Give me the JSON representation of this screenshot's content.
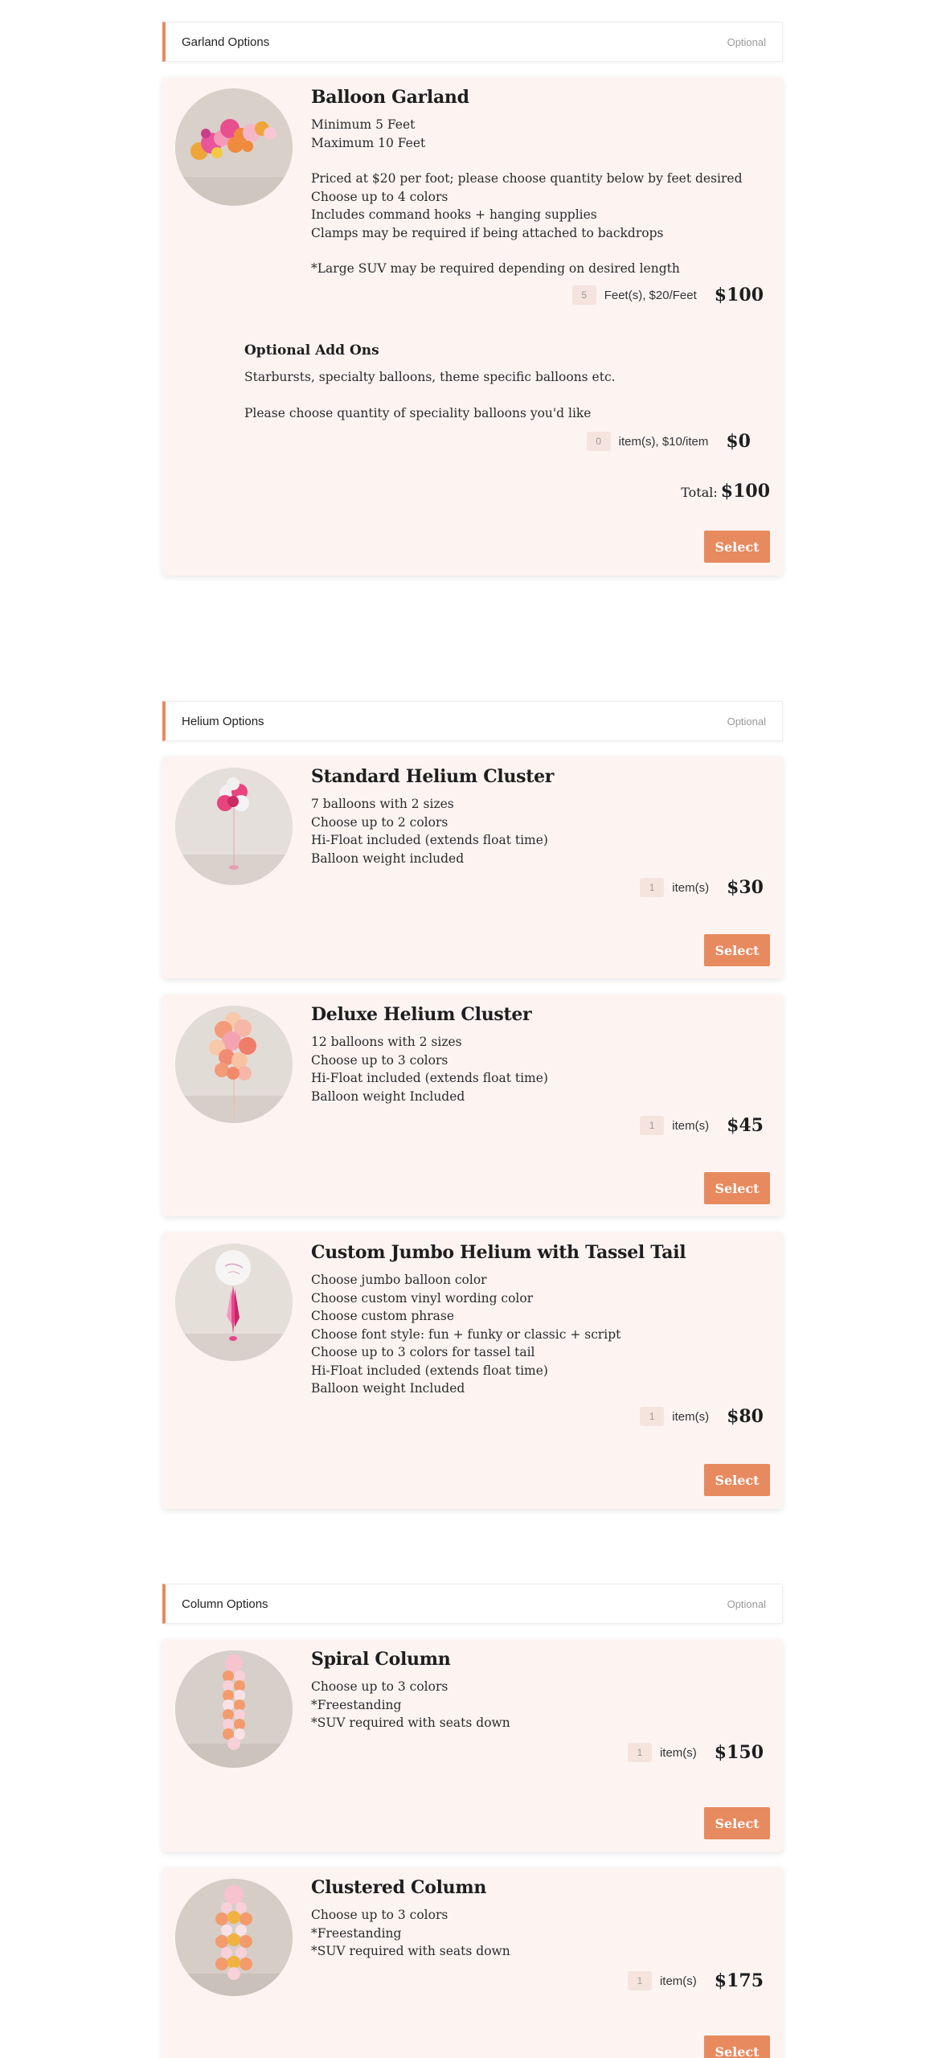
{
  "sections": {
    "garland": {
      "title": "Garland Options",
      "optional": "Optional"
    },
    "helium": {
      "title": "Helium Options",
      "optional": "Optional"
    },
    "column": {
      "title": "Column Options",
      "optional": "Optional"
    }
  },
  "garland": {
    "title": "Balloon Garland",
    "lines": [
      "Minimum 5 Feet",
      "Maximum 10 Feet",
      "",
      "Priced at $20 per foot; please choose quantity below by feet desired",
      "Choose up to 4 colors",
      "Includes command hooks + hanging supplies",
      "Clamps may be required if being attached to backdrops",
      "",
      "*Large SUV may be required depending on desired length"
    ],
    "qty": "5",
    "unit": "Feet(s), $20/Feet",
    "price": "$100",
    "addons": {
      "title": "Optional Add Ons",
      "line1": "Starbursts, specialty balloons, theme specific balloons etc.",
      "line2": "Please choose quantity of speciality balloons you'd like",
      "qty": "0",
      "unit": "item(s), $10/item",
      "price": "$0"
    },
    "total_label": "Total:",
    "total": "$100",
    "select": "Select"
  },
  "standard_helium": {
    "title": "Standard Helium Cluster",
    "lines": [
      "7 balloons with 2 sizes",
      "Choose up to 2 colors",
      "Hi-Float included (extends float time)",
      "Balloon weight included"
    ],
    "qty": "1",
    "unit": "item(s)",
    "price": "$30",
    "select": "Select"
  },
  "deluxe_helium": {
    "title": "Deluxe Helium Cluster",
    "lines": [
      "12 balloons with 2 sizes",
      "Choose up to 3 colors",
      "Hi-Float included (extends float time)",
      "Balloon weight Included"
    ],
    "qty": "1",
    "unit": "item(s)",
    "price": "$45",
    "select": "Select"
  },
  "jumbo_helium": {
    "title": "Custom Jumbo Helium with Tassel Tail",
    "lines": [
      "Choose jumbo balloon color",
      "Choose custom vinyl wording color",
      "Choose custom phrase",
      "Choose font style: fun + funky or classic + script",
      "Choose up to 3 colors for tassel tail",
      "Hi-Float included (extends float time)",
      "Balloon weight Included"
    ],
    "qty": "1",
    "unit": "item(s)",
    "price": "$80",
    "select": "Select"
  },
  "spiral_column": {
    "title": "Spiral Column",
    "lines": [
      "Choose up to 3 colors",
      "*Freestanding",
      "*SUV required with seats down"
    ],
    "qty": "1",
    "unit": "item(s)",
    "price": "$150",
    "select": "Select"
  },
  "clustered_column": {
    "title": "Clustered Column",
    "lines": [
      "Choose up to 3 colors",
      "*Freestanding",
      "*SUV required with seats down"
    ],
    "qty": "1",
    "unit": "item(s)",
    "price": "$175",
    "select": "Select"
  },
  "colors": {
    "accent": "#e78a5f",
    "card_bg": "#fdf4f2",
    "qty_bg": "#f5e3de"
  }
}
